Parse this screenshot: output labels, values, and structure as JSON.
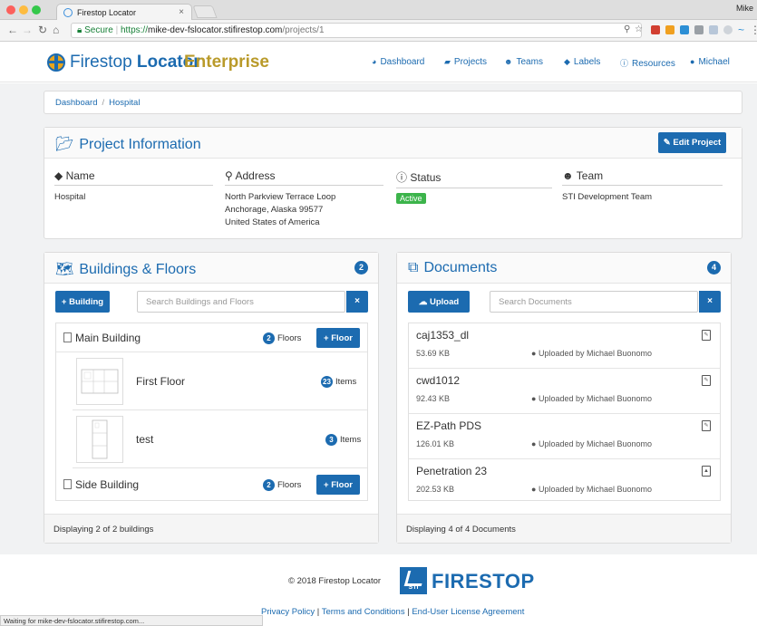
{
  "browser": {
    "tab_title": "Firestop Locator",
    "profile": "Mike",
    "url_secure": "Secure",
    "url_scheme": "https://",
    "url_host": "mike-dev-fslocator.stifirestop.com",
    "url_path": "/projects/1",
    "status_text": "Waiting for mike-dev-fslocator.stifirestop.com..."
  },
  "navbar": {
    "logo_part1": "Firestop ",
    "logo_part2": "Locator",
    "edition": "Enterprise",
    "items": [
      "Dashboard",
      "Projects",
      "Teams",
      "Labels",
      "Resources",
      "Michael"
    ]
  },
  "breadcrumb": {
    "root": "Dashboard",
    "current": "Hospital"
  },
  "project": {
    "title": "Project Information",
    "edit_label": "Edit Project",
    "name_label": "Name",
    "name": "Hospital",
    "address_label": "Address",
    "address": [
      "North Parkview Terrace Loop",
      "Anchorage, Alaska 99577",
      "United States of America"
    ],
    "status_label": "Status",
    "status": "Active",
    "team_label": "Team",
    "team": "STI Development Team"
  },
  "buildings": {
    "title": "Buildings & Floors",
    "count": "2",
    "add_label": "+ Building",
    "search_placeholder": "Search Buildings and Floors",
    "clear": "×",
    "floors_word": "Floors",
    "items_word": "Items",
    "add_floor": "+ Floor",
    "list": [
      {
        "name": "Main Building",
        "floors": "2"
      },
      {
        "name": "Side Building",
        "floors": "2"
      }
    ],
    "floors": [
      {
        "name": "First Floor",
        "items": "23"
      },
      {
        "name": "test",
        "items": "3"
      }
    ],
    "footer": "Displaying 2 of 2 buildings"
  },
  "documents": {
    "title": "Documents",
    "count": "4",
    "upload_label": "Upload",
    "search_placeholder": "Search Documents",
    "clear": "×",
    "list": [
      {
        "name": "caj1353_dl",
        "size": "53.69 KB",
        "uploader": "Uploaded by Michael Buonomo",
        "type": "pdf"
      },
      {
        "name": "cwd1012",
        "size": "92.43 KB",
        "uploader": "Uploaded by Michael Buonomo",
        "type": "pdf"
      },
      {
        "name": "EZ-Path PDS",
        "size": "126.01 KB",
        "uploader": "Uploaded by Michael Buonomo",
        "type": "pdf"
      },
      {
        "name": "Penetration 23",
        "size": "202.53 KB",
        "uploader": "Uploaded by Michael Buonomo",
        "type": "image"
      }
    ],
    "footer": "Displaying 4 of 4 Documents"
  },
  "footer": {
    "copyright": "© 2018 Firestop Locator",
    "brand_small": "STI",
    "brand": "FIRESTOP",
    "privacy": "Privacy Policy",
    "terms": "Terms and Conditions",
    "eula": "End-User License Agreement",
    "sep": " | "
  },
  "colors": {
    "primary": "#1c6bb0",
    "accent": "#b99a2a",
    "success": "#3cb44b"
  }
}
